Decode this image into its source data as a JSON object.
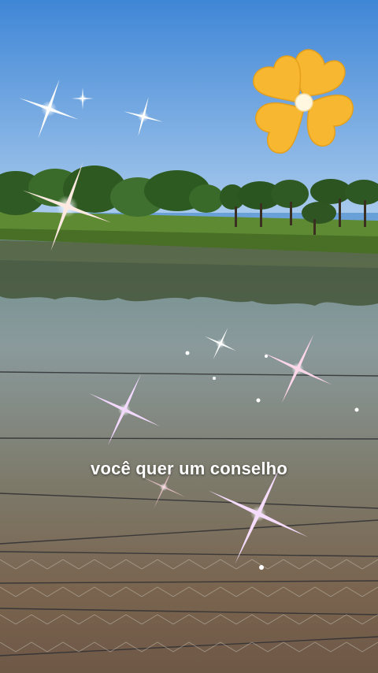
{
  "caption": "você quer um conselho",
  "sticker": {
    "icon": "flower-icon",
    "petal_color": "#f7b731",
    "center_color": "#fff7e0"
  },
  "effects": {
    "icon": "sparkle-icon"
  },
  "colors": {
    "sky": "#5d9be0",
    "water": "#7f8a86",
    "grass": "#4f7a2e"
  }
}
